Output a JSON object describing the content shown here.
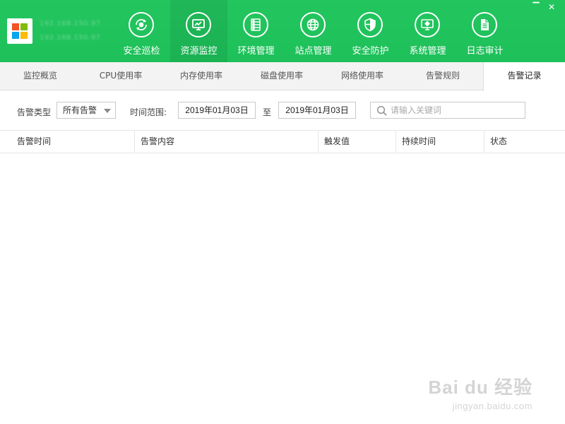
{
  "header": {
    "host_line1": "192.168.150.97",
    "host_line2": "192.168.150.97",
    "nav": [
      {
        "label": "安全巡检",
        "icon": "radar-icon"
      },
      {
        "label": "资源监控",
        "icon": "monitor-chart-icon"
      },
      {
        "label": "环境管理",
        "icon": "server-icon"
      },
      {
        "label": "站点管理",
        "icon": "globe-icon"
      },
      {
        "label": "安全防护",
        "icon": "shield-icon"
      },
      {
        "label": "系统管理",
        "icon": "gear-monitor-icon"
      },
      {
        "label": "日志审计",
        "icon": "document-icon"
      }
    ],
    "active_nav": "资源监控",
    "minimize_symbol": "▔",
    "close_symbol": "✕"
  },
  "tabs": [
    "监控概览",
    "CPU使用率",
    "内存使用率",
    "磁盘使用率",
    "网络使用率",
    "告警规则",
    "告警记录"
  ],
  "active_tab": "告警记录",
  "filters": {
    "type_label": "告警类型",
    "type_value": "所有告警",
    "time_label": "时间范围:",
    "date_from": "2019年01月03日",
    "to_label": "至",
    "date_to": "2019年01月03日",
    "search_placeholder": "请输入关键词"
  },
  "table": {
    "columns": [
      "告警时间",
      "告警内容",
      "触发值",
      "持续时间",
      "状态"
    ],
    "rows": []
  },
  "watermark": {
    "brand": "Bai du 经验",
    "url": "jingyan.baidu.com"
  },
  "colors": {
    "header_green": "#22c55e",
    "tab_bar": "#f3f3f3"
  }
}
